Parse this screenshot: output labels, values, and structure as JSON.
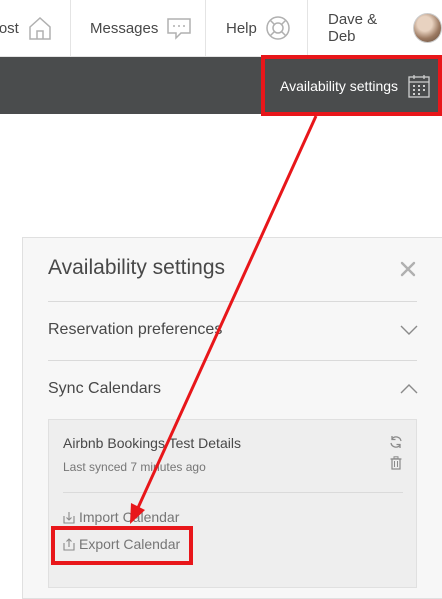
{
  "nav": {
    "host_label": "Host",
    "messages_label": "Messages",
    "help_label": "Help",
    "user_name": "Dave & Deb"
  },
  "toolbar": {
    "availability_label": "Availability settings"
  },
  "panel": {
    "title": "Availability settings",
    "sections": [
      {
        "label": "Reservation preferences",
        "expanded": false
      },
      {
        "label": "Sync Calendars",
        "expanded": true
      }
    ],
    "calendar": {
      "name": "Airbnb Bookings Test Details",
      "last_synced": "Last synced 7 minutes ago"
    },
    "import_label": "Import Calendar",
    "export_label": "Export Calendar"
  },
  "annotation": {
    "highlight_color": "#e8161a"
  }
}
